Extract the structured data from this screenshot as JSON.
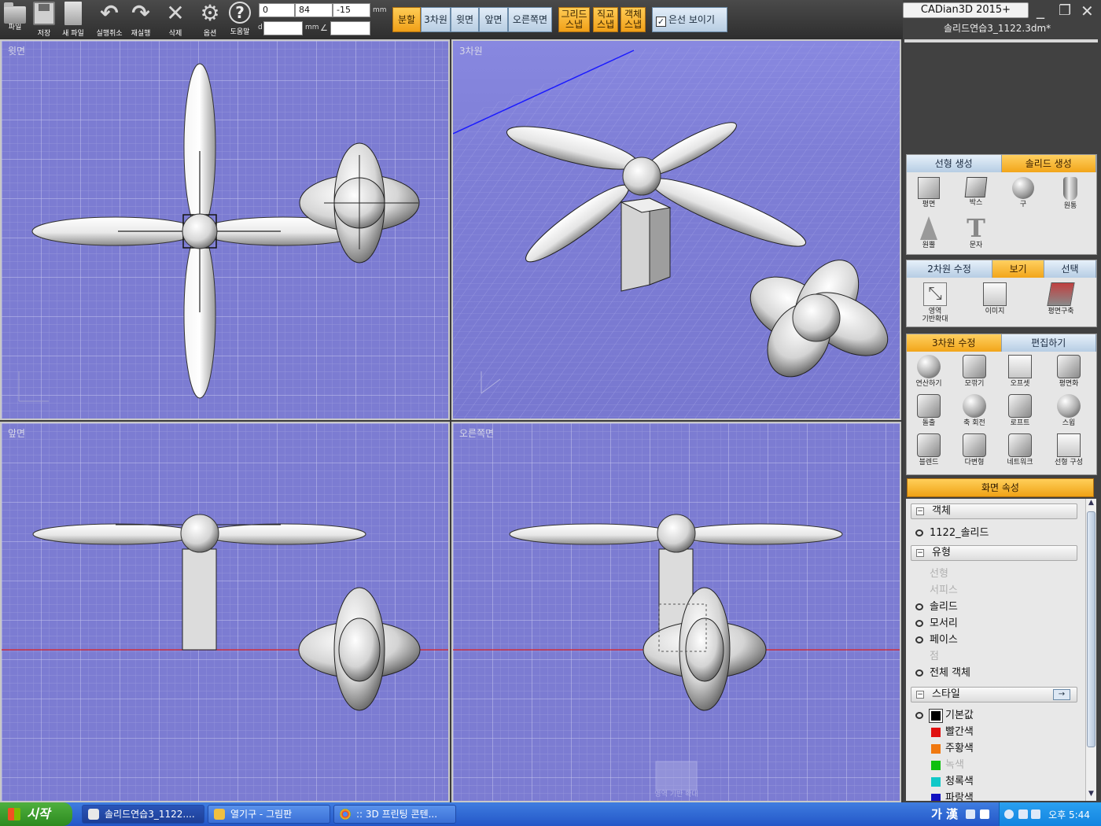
{
  "toolbar": {
    "tools": [
      {
        "label": "파일",
        "icon": "folder-icon"
      },
      {
        "label": "저장",
        "icon": "save-icon"
      },
      {
        "label": "새 파일",
        "icon": "new-file-icon"
      },
      {
        "label": "실행취소",
        "icon": "undo-icon"
      },
      {
        "label": "재실행",
        "icon": "redo-icon"
      },
      {
        "label": "삭제",
        "icon": "delete-icon"
      },
      {
        "label": "옵션",
        "icon": "gear-icon"
      },
      {
        "label": "도움말",
        "icon": "help-icon"
      }
    ],
    "coords": {
      "x": "0",
      "y": "84",
      "z": "-15",
      "d": "",
      "angle": ""
    },
    "units": {
      "mm1": "mm",
      "d": "d",
      "mm2": "mm",
      "angle": "∠"
    },
    "view_buttons": [
      "분할",
      "3차원",
      "윗면",
      "앞면",
      "오른쪽면"
    ],
    "snap_buttons": [
      {
        "line1": "그리드",
        "line2": "스냅"
      },
      {
        "line1": "직교",
        "line2": "스냅"
      },
      {
        "line1": "객체",
        "line2": "스냅"
      }
    ],
    "hidden_line": {
      "label": "은선 보이기",
      "checked": true
    }
  },
  "viewports": {
    "top": {
      "label": "윗면"
    },
    "iso": {
      "label": "3차원"
    },
    "front": {
      "label": "앞면"
    },
    "right": {
      "label": "오른쪽면"
    },
    "right_watermark": "영역 기반 확대"
  },
  "app": {
    "title": "CADian3D 2015+",
    "file_name": "솔리드연습3_1122.3dm*",
    "window_controls": {
      "minimize": "_",
      "restore": "❐",
      "close": "✕"
    }
  },
  "panels": {
    "create": {
      "tabs": [
        "선형 생성",
        "솔리드 생성"
      ],
      "active_tab": 1,
      "items": [
        {
          "label": "평면",
          "icon": "plane-icon"
        },
        {
          "label": "박스",
          "icon": "box-icon"
        },
        {
          "label": "구",
          "icon": "sphere-icon"
        },
        {
          "label": "원통",
          "icon": "cylinder-icon"
        },
        {
          "label": "원뿔",
          "icon": "cone-icon"
        },
        {
          "label": "문자",
          "icon": "text-icon"
        }
      ]
    },
    "view": {
      "tabs": [
        "2차원 수정",
        "보기",
        "선택"
      ],
      "active_tab": 1,
      "items": [
        {
          "label": "영역 기반 확대",
          "line1": "영역",
          "line2": "기반확대",
          "icon": "zoom-window-icon"
        },
        {
          "label": "이미지",
          "icon": "image-icon"
        },
        {
          "label": "평면구축",
          "icon": "construction-plane-icon"
        }
      ]
    },
    "edit3d": {
      "tabs": [
        "3차원 수정",
        "편집하기"
      ],
      "active_tab": 0,
      "items": [
        {
          "label": "연산하기",
          "icon": "boolean-icon"
        },
        {
          "label": "모깎기",
          "icon": "fillet-icon"
        },
        {
          "label": "오프셋",
          "icon": "offset-icon"
        },
        {
          "label": "평면화",
          "icon": "flatten-icon"
        },
        {
          "label": "돌출",
          "icon": "extrude-icon"
        },
        {
          "label": "축 회전",
          "icon": "revolve-icon"
        },
        {
          "label": "로프트",
          "icon": "loft-icon"
        },
        {
          "label": "스윕",
          "icon": "sweep-icon"
        },
        {
          "label": "블렌드",
          "icon": "blend-icon"
        },
        {
          "label": "다변형",
          "icon": "polygon-icon"
        },
        {
          "label": "네트워크",
          "icon": "network-icon"
        },
        {
          "label": "선형 구성",
          "icon": "curve-structure-icon"
        }
      ]
    }
  },
  "properties": {
    "title": "화면 속성",
    "sections": {
      "object": "객체",
      "type": "유형",
      "style": "스타일"
    },
    "object_item": "1122_솔리드",
    "types": [
      {
        "label": "선형",
        "enabled": false,
        "eye": false
      },
      {
        "label": "서피스",
        "enabled": false,
        "eye": false
      },
      {
        "label": "솔리드",
        "enabled": true,
        "eye": true
      },
      {
        "label": "모서리",
        "enabled": true,
        "eye": true
      },
      {
        "label": "페이스",
        "enabled": true,
        "eye": true
      },
      {
        "label": "점",
        "enabled": false,
        "eye": false
      },
      {
        "label": "전체 객체",
        "enabled": true,
        "eye": true
      }
    ],
    "styles": [
      {
        "label": "기본값",
        "color": "#000000",
        "enabled": true,
        "eye": true
      },
      {
        "label": "빨간색",
        "color": "#e01010",
        "enabled": true,
        "eye": false
      },
      {
        "label": "주황색",
        "color": "#f07810",
        "enabled": true,
        "eye": false
      },
      {
        "label": "녹색",
        "color": "#10c010",
        "enabled": false,
        "eye": false
      },
      {
        "label": "청록색",
        "color": "#10c8c8",
        "enabled": true,
        "eye": false
      },
      {
        "label": "파랑색",
        "color": "#1010c0",
        "enabled": true,
        "eye": false
      }
    ],
    "style_go": "→"
  },
  "taskbar": {
    "start": "시작",
    "tasks": [
      {
        "label": "솔리드연습3_1122....",
        "active": true
      },
      {
        "label": "열기구 - 그림판",
        "active": false
      },
      {
        "label": ":: 3D 프린팅 콘텐...",
        "active": false
      }
    ],
    "ime": "가 漢",
    "clock": "오후 5:44"
  },
  "colors": {
    "viewport_bg": "#7c7cd2",
    "grid_minor": "#9c9ce0",
    "grid_major": "#c4c4ec",
    "accent_orange": "#f2a51a",
    "accent_blue": "#b8cde2"
  }
}
